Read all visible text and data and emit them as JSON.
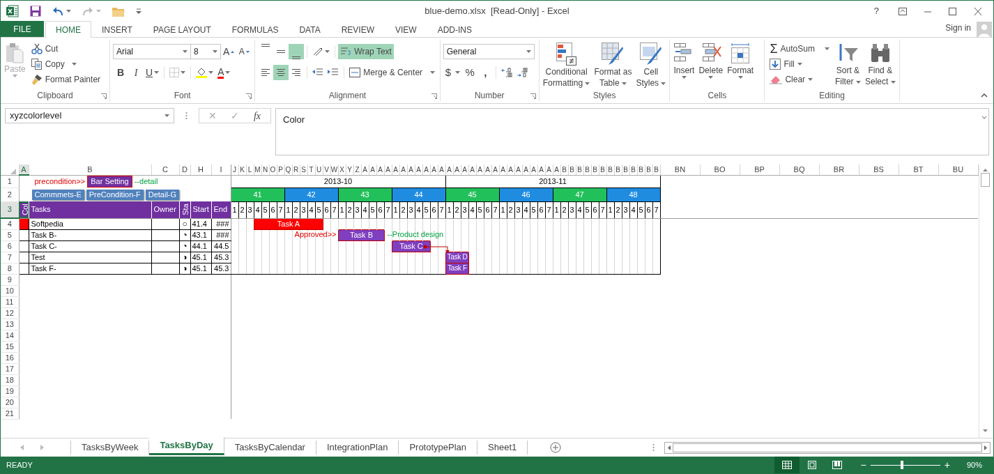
{
  "window": {
    "title": "blue-demo.xlsx  [Read-Only] - Excel",
    "help": "?"
  },
  "ribbon_tabs": [
    {
      "label": "FILE",
      "kind": "file",
      "selected": false
    },
    {
      "label": "HOME",
      "kind": "tab",
      "selected": true
    },
    {
      "label": "INSERT",
      "kind": "tab",
      "selected": false
    },
    {
      "label": "PAGE LAYOUT",
      "kind": "tab",
      "selected": false
    },
    {
      "label": "FORMULAS",
      "kind": "tab",
      "selected": false
    },
    {
      "label": "DATA",
      "kind": "tab",
      "selected": false
    },
    {
      "label": "REVIEW",
      "kind": "tab",
      "selected": false
    },
    {
      "label": "VIEW",
      "kind": "tab",
      "selected": false
    },
    {
      "label": "ADD-INS",
      "kind": "tab",
      "selected": false
    }
  ],
  "sign_in": "Sign in",
  "ribbon": [
    {
      "kind": "clipboard",
      "label": "Clipboard",
      "paste": {
        "label": "Paste",
        "disabled": true
      },
      "cut": "Cut",
      "copy": "Copy",
      "format_painter": "Format Painter"
    },
    {
      "kind": "font",
      "label": "Font",
      "font_name": "Arial",
      "font_size": "8",
      "grow": "A",
      "shrink": "A",
      "bold": "B",
      "italic": "I",
      "underline": "U",
      "font_color": "A"
    },
    {
      "kind": "alignment",
      "label": "Alignment",
      "vertical": [
        {
          "selected": false
        },
        {
          "selected": false
        },
        {
          "selected": true
        }
      ],
      "horizontal": [
        {
          "selected": false
        },
        {
          "selected": true
        },
        {
          "selected": false
        }
      ],
      "wrap_text": {
        "label": "Wrap Text",
        "on": true
      },
      "merge": "Merge & Center"
    },
    {
      "kind": "number",
      "label": "Number",
      "format": "General",
      "currency": "$",
      "percent": "%",
      "comma": ","
    },
    {
      "kind": "styles",
      "label": "Styles",
      "buttons": [
        {
          "lines": [
            "Conditional",
            "Formatting"
          ]
        },
        {
          "lines": [
            "Format as",
            "Table"
          ]
        },
        {
          "lines": [
            "Cell",
            "Styles"
          ]
        }
      ]
    },
    {
      "kind": "cells",
      "label": "Cells",
      "buttons": [
        "Insert",
        "Delete",
        "Format"
      ]
    },
    {
      "kind": "editing",
      "label": "Editing",
      "sigma": "Σ",
      "autosum": "AutoSum",
      "fill": "Fill",
      "clear": "Clear",
      "buttons": [
        {
          "lines": [
            "Sort &",
            "Filter"
          ]
        },
        {
          "lines": [
            "Find &",
            "Select"
          ]
        }
      ]
    }
  ],
  "formula_bar": {
    "name_box": "xyzcolorlevel",
    "cancel": {
      "label": "✕",
      "disabled": true
    },
    "enter": {
      "label": "✓",
      "disabled": true
    },
    "fx": "fx",
    "formula": "Color"
  },
  "sheet": {
    "columns": [
      {
        "label": "A",
        "selected": true
      },
      {
        "label": "B",
        "selected": false
      },
      {
        "label": "C",
        "selected": false
      },
      {
        "label": "D",
        "selected": false
      },
      {
        "label": "H",
        "selected": false
      },
      {
        "label": "I",
        "selected": false
      },
      {
        "label": "J",
        "selected": false
      },
      {
        "label": "K",
        "selected": false
      },
      {
        "label": "L",
        "selected": false
      },
      {
        "label": "M",
        "selected": false
      },
      {
        "label": "N",
        "selected": false
      },
      {
        "label": "O",
        "selected": false
      },
      {
        "label": "P",
        "selected": false
      },
      {
        "label": "Q",
        "selected": false
      },
      {
        "label": "R",
        "selected": false
      },
      {
        "label": "S",
        "selected": false
      },
      {
        "label": "T",
        "selected": false
      },
      {
        "label": "U",
        "selected": false
      },
      {
        "label": "V",
        "selected": false
      },
      {
        "label": "W",
        "selected": false
      },
      {
        "label": "X",
        "selected": false
      },
      {
        "label": "Y",
        "selected": false
      },
      {
        "label": "Z",
        "selected": false
      },
      {
        "label": "A",
        "selected": false
      },
      {
        "label": "A",
        "selected": false
      },
      {
        "label": "A",
        "selected": false
      },
      {
        "label": "A",
        "selected": false
      },
      {
        "label": "A",
        "selected": false
      },
      {
        "label": "A",
        "selected": false
      },
      {
        "label": "A",
        "selected": false
      },
      {
        "label": "A",
        "selected": false
      },
      {
        "label": "A",
        "selected": false
      },
      {
        "label": "A",
        "selected": false
      },
      {
        "label": "A",
        "selected": false
      },
      {
        "label": "A",
        "selected": false
      },
      {
        "label": "A",
        "selected": false
      },
      {
        "label": "A",
        "selected": false
      },
      {
        "label": "A",
        "selected": false
      },
      {
        "label": "A",
        "selected": false
      },
      {
        "label": "A",
        "selected": false
      },
      {
        "label": "A",
        "selected": false
      },
      {
        "label": "A",
        "selected": false
      },
      {
        "label": "A",
        "selected": false
      },
      {
        "label": "A",
        "selected": false
      },
      {
        "label": "A",
        "selected": false
      },
      {
        "label": "A",
        "selected": false
      },
      {
        "label": "A",
        "selected": false
      },
      {
        "label": "A",
        "selected": false
      },
      {
        "label": "A",
        "selected": false
      },
      {
        "label": "B",
        "selected": false
      },
      {
        "label": "B",
        "selected": false
      },
      {
        "label": "B",
        "selected": false
      },
      {
        "label": "B",
        "selected": false
      },
      {
        "label": "B",
        "selected": false
      },
      {
        "label": "B",
        "selected": false
      },
      {
        "label": "B",
        "selected": false
      },
      {
        "label": "B",
        "selected": false
      },
      {
        "label": "B",
        "selected": false
      },
      {
        "label": "B",
        "selected": false
      },
      {
        "label": "B",
        "selected": false
      },
      {
        "label": "B",
        "selected": false
      },
      {
        "label": "B",
        "selected": false
      },
      {
        "label": "BN",
        "selected": false
      },
      {
        "label": "BO",
        "selected": false
      },
      {
        "label": "BP",
        "selected": false
      },
      {
        "label": "BQ",
        "selected": false
      },
      {
        "label": "BR",
        "selected": false
      },
      {
        "label": "BS",
        "selected": false
      },
      {
        "label": "BT",
        "selected": false
      },
      {
        "label": "BU",
        "selected": false
      }
    ],
    "row_numbers": [
      {
        "label": "1",
        "selected": false
      },
      {
        "label": "2",
        "selected": false
      },
      {
        "label": "3",
        "selected": true
      },
      {
        "label": "4",
        "selected": false
      },
      {
        "label": "5",
        "selected": false
      },
      {
        "label": "6",
        "selected": false
      },
      {
        "label": "7",
        "selected": false
      },
      {
        "label": "8",
        "selected": false
      },
      {
        "label": "9",
        "selected": false
      },
      {
        "label": "10",
        "selected": false
      },
      {
        "label": "11",
        "selected": false
      },
      {
        "label": "12",
        "selected": false
      },
      {
        "label": "13",
        "selected": false
      },
      {
        "label": "14",
        "selected": false
      },
      {
        "label": "15",
        "selected": false
      },
      {
        "label": "16",
        "selected": false
      },
      {
        "label": "17",
        "selected": false
      },
      {
        "label": "18",
        "selected": false
      },
      {
        "label": "19",
        "selected": false
      },
      {
        "label": "20",
        "selected": false
      },
      {
        "label": "21",
        "selected": false
      }
    ],
    "row1": {
      "precondition": "precondition>>",
      "bar_setting": "Bar Setting",
      "detail": "--detail"
    },
    "row2_buttons": [
      "Commmets-E",
      "PreCondition-F",
      "Detail-G"
    ],
    "months": [
      {
        "label": "2013-10",
        "weeks": [
          {
            "label": "41",
            "color": "#22c05a",
            "days": [
              "1",
              "2",
              "3",
              "4",
              "5",
              "6",
              "7"
            ]
          },
          {
            "label": "42",
            "color": "#1f8ce0",
            "days": [
              "1",
              "2",
              "3",
              "4",
              "5",
              "6",
              "7"
            ]
          },
          {
            "label": "43",
            "color": "#22c05a",
            "days": [
              "1",
              "2",
              "3",
              "4",
              "5",
              "6",
              "7"
            ]
          },
          {
            "label": "44",
            "color": "#1f8ce0",
            "days": [
              "1",
              "2",
              "3",
              "4",
              "5",
              "6",
              "7"
            ]
          }
        ]
      },
      {
        "label": "2013-11",
        "weeks": [
          {
            "label": "45",
            "color": "#22c05a",
            "days": [
              "1",
              "2",
              "3",
              "4",
              "5",
              "6",
              "7"
            ]
          },
          {
            "label": "46",
            "color": "#1f8ce0",
            "days": [
              "1",
              "2",
              "3",
              "4",
              "5",
              "6",
              "7"
            ]
          },
          {
            "label": "47",
            "color": "#22c05a",
            "days": [
              "1",
              "2",
              "3",
              "4",
              "5",
              "6",
              "7"
            ]
          },
          {
            "label": "48",
            "color": "#1f8ce0",
            "days": [
              "1",
              "2",
              "3",
              "4",
              "5",
              "6",
              "7"
            ]
          }
        ]
      }
    ],
    "header": {
      "col": "Col",
      "tasks": "Tasks",
      "owner": "Owner",
      "status": "Sta",
      "start": "Start",
      "end": "End"
    },
    "tasks": [
      {
        "color": "#ff0000",
        "name": "Softpedia",
        "status": "○",
        "start": "41.4",
        "end": "###",
        "bar": {
          "label": "Task A",
          "color": "#ff0000",
          "days": [
            false,
            false,
            false,
            true,
            true,
            true,
            true,
            true,
            true,
            true,
            true,
            true,
            false,
            false,
            false,
            false,
            false,
            false,
            false,
            false,
            false,
            false,
            false,
            false,
            false,
            false,
            false,
            false,
            false,
            false,
            false,
            false,
            false,
            false,
            false,
            false,
            false,
            false,
            false,
            false,
            false,
            false,
            false,
            false,
            false,
            false,
            false,
            false,
            false,
            false,
            false,
            false,
            false,
            false,
            false,
            false
          ]
        }
      },
      {
        "name": "Task B-",
        "status": "◔",
        "start": "43.1",
        "end": "###",
        "bar": {
          "label": "Task B",
          "color": "#7f3fbf",
          "days": [
            false,
            false,
            false,
            false,
            false,
            false,
            false,
            false,
            false,
            false,
            false,
            false,
            false,
            false,
            true,
            true,
            true,
            true,
            true,
            true,
            false,
            false,
            false,
            false,
            false,
            false,
            false,
            false,
            false,
            false,
            false,
            false,
            false,
            false,
            false,
            false,
            false,
            false,
            false,
            false,
            false,
            false,
            false,
            false,
            false,
            false,
            false,
            false,
            false,
            false,
            false,
            false,
            false,
            false,
            false,
            false
          ],
          "before": "Approved>>",
          "after": "--Product design"
        }
      },
      {
        "name": "Task C-",
        "status": "◔",
        "start": "44.1",
        "end": "44.5",
        "bar": {
          "label": "Task C",
          "color": "#7f3fbf",
          "days": [
            false,
            false,
            false,
            false,
            false,
            false,
            false,
            false,
            false,
            false,
            false,
            false,
            false,
            false,
            false,
            false,
            false,
            false,
            false,
            false,
            false,
            true,
            true,
            true,
            true,
            true,
            false,
            false,
            false,
            false,
            false,
            false,
            false,
            false,
            false,
            false,
            false,
            false,
            false,
            false,
            false,
            false,
            false,
            false,
            false,
            false,
            false,
            false,
            false,
            false,
            false,
            false,
            false,
            false,
            false,
            false
          ],
          "linked_to_next": true
        }
      },
      {
        "name": "Test",
        "status": "◑",
        "start": "45.1",
        "end": "45.3",
        "bar": {
          "label": "Task D",
          "color": "#7f3fbf",
          "days": [
            false,
            false,
            false,
            false,
            false,
            false,
            false,
            false,
            false,
            false,
            false,
            false,
            false,
            false,
            false,
            false,
            false,
            false,
            false,
            false,
            false,
            false,
            false,
            false,
            false,
            false,
            false,
            false,
            true,
            true,
            true,
            false,
            false,
            false,
            false,
            false,
            false,
            false,
            false,
            false,
            false,
            false,
            false,
            false,
            false,
            false,
            false,
            false,
            false,
            false,
            false,
            false,
            false,
            false,
            false,
            false
          ]
        }
      },
      {
        "name": "Task F-",
        "status": "◑",
        "start": "45.1",
        "end": "45.3",
        "bar": {
          "label": "Task F",
          "color": "#7f3fbf",
          "days": [
            false,
            false,
            false,
            false,
            false,
            false,
            false,
            false,
            false,
            false,
            false,
            false,
            false,
            false,
            false,
            false,
            false,
            false,
            false,
            false,
            false,
            false,
            false,
            false,
            false,
            false,
            false,
            false,
            true,
            true,
            true,
            false,
            false,
            false,
            false,
            false,
            false,
            false,
            false,
            false,
            false,
            false,
            false,
            false,
            false,
            false,
            false,
            false,
            false,
            false,
            false,
            false,
            false,
            false,
            false,
            false
          ]
        }
      }
    ]
  },
  "sheet_tabs": [
    {
      "label": "TasksByWeek",
      "selected": false
    },
    {
      "label": "TasksByDay",
      "selected": true
    },
    {
      "label": "TasksByCalendar",
      "selected": false
    },
    {
      "label": "IntegrationPlan",
      "selected": false
    },
    {
      "label": "PrototypePlan",
      "selected": false
    },
    {
      "label": "Sheet1",
      "selected": false
    }
  ],
  "status_bar": {
    "ready": "READY",
    "views": [
      {
        "selected": true
      },
      {
        "selected": false
      },
      {
        "selected": false
      }
    ],
    "minus": "−",
    "plus": "+",
    "zoom": {
      "level": 0.45,
      "reading": "90%"
    }
  }
}
